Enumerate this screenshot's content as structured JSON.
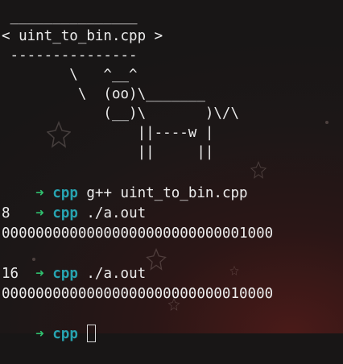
{
  "cowsay": {
    "lines": [
      " _______________",
      "< uint_to_bin.cpp >",
      " ---------------",
      "        \\   ^__^",
      "         \\  (oo)\\_______",
      "            (__)\\       )\\/\\",
      "                ||----w |",
      "                ||     ||"
    ]
  },
  "session": [
    {
      "prompt": "➜",
      "dir": "cpp",
      "command": " g++ uint_to_bin.cpp"
    },
    {
      "prompt": "➜",
      "dir": "cpp",
      "command": " ./a.out"
    },
    {
      "output": "8"
    },
    {
      "output": "00000000000000000000000000001000"
    },
    {
      "prompt": "➜",
      "dir": "cpp",
      "command": " ./a.out"
    },
    {
      "output": "16"
    },
    {
      "output": "00000000000000000000000000010000"
    },
    {
      "prompt": "➜",
      "dir": "cpp",
      "command": " "
    }
  ]
}
